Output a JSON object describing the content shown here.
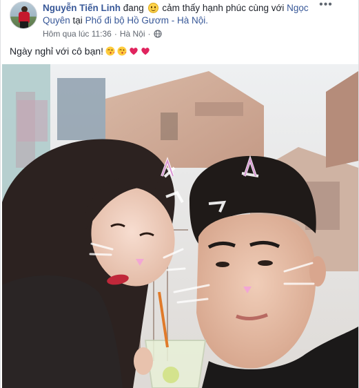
{
  "post": {
    "author": "Nguyễn Tiến Linh",
    "activity_pre": "đang",
    "activity": "cảm thấy hạnh phúc cùng với",
    "tagged": "Ngọc Quyên",
    "at_word": "tại",
    "place": "Phố đi bộ Hồ Gươm - Hà Nội.",
    "time": "Hôm qua lúc 11:36",
    "location": "Hà Nội",
    "separator": "·",
    "more_label": "•••",
    "text": "Ngày nghỉ với cô bạn!",
    "emojis": [
      "kiss-face",
      "kiss-face",
      "red-heart",
      "red-heart"
    ],
    "privacy_icon": "globe-icon"
  },
  "colors": {
    "link": "#385898",
    "meta": "#616770",
    "heart": "#e0245e"
  }
}
